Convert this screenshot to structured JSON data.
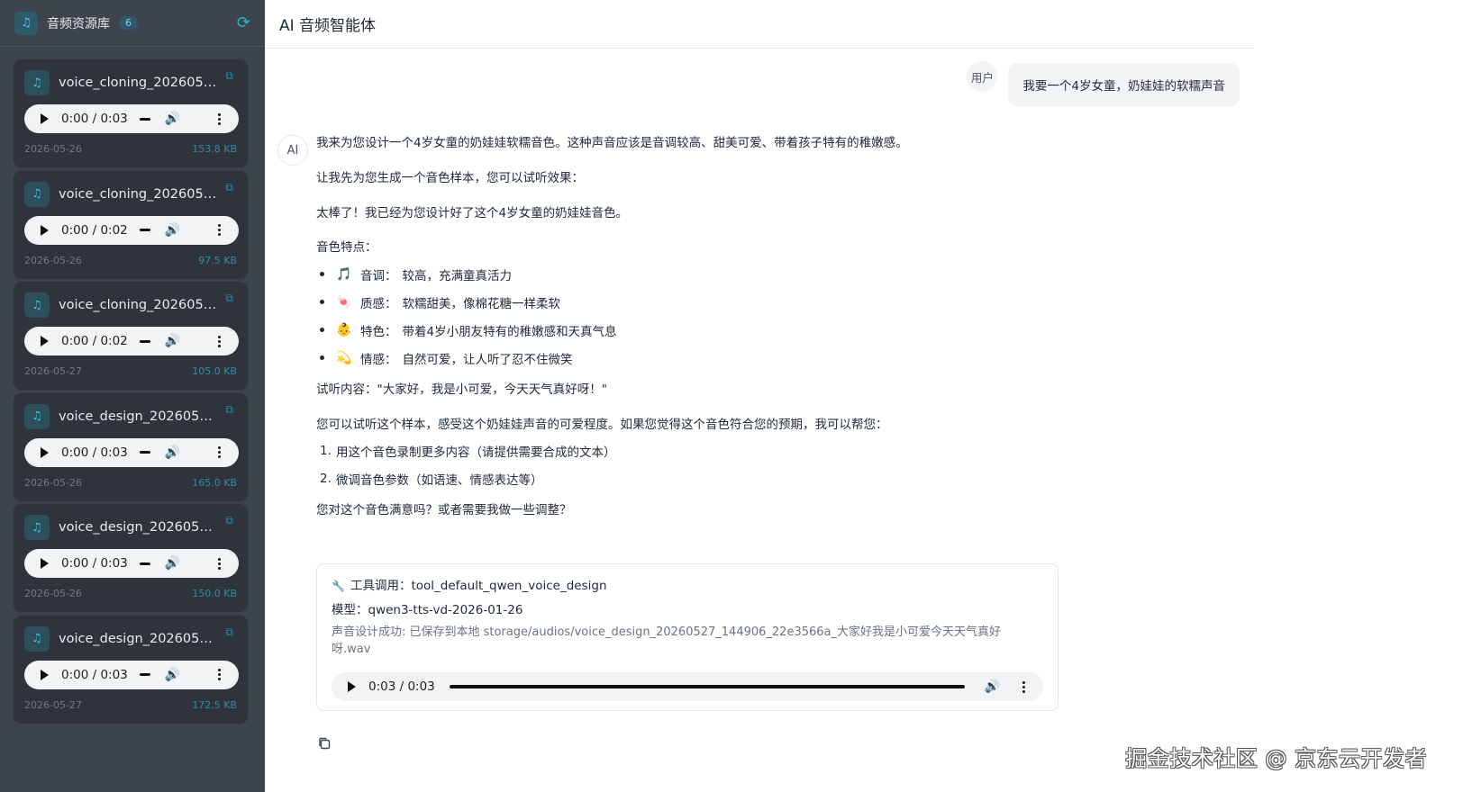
{
  "sidebar": {
    "title": "音频资源库",
    "count": "6",
    "music_icon": "music-note-icon",
    "refresh_icon": "refresh-icon",
    "items": [
      {
        "name": "voice_cloning_2026052...",
        "time": "0:00 / 0:03",
        "date": "2026-05-26",
        "size": "153.8 KB"
      },
      {
        "name": "voice_cloning_2026052...",
        "time": "0:00 / 0:02",
        "date": "2026-05-26",
        "size": "97.5 KB"
      },
      {
        "name": "voice_cloning_2026052...",
        "time": "0:00 / 0:02",
        "date": "2026-05-27",
        "size": "105.0 KB"
      },
      {
        "name": "voice_design_2026052...",
        "time": "0:00 / 0:03",
        "date": "2026-05-26",
        "size": "165.0 KB"
      },
      {
        "name": "voice_design_2026052...",
        "time": "0:00 / 0:03",
        "date": "2026-05-26",
        "size": "150.0 KB"
      },
      {
        "name": "voice_design_2026052...",
        "time": "0:00 / 0:03",
        "date": "2026-05-27",
        "size": "172.5 KB"
      }
    ]
  },
  "header": {
    "title": "AI 音频智能体"
  },
  "user": {
    "label": "用户",
    "message": "我要一个4岁女童，奶娃娃的软糯声音"
  },
  "ai": {
    "label": "AI",
    "p1": "我来为您设计一个4岁女童的奶娃娃软糯音色。这种声音应该是音调较高、甜美可爱、带着孩子特有的稚嫩感。",
    "p2": "让我先为您生成一个音色样本，您可以试听效果：",
    "p3": "太棒了！我已经为您设计好了这个4岁女童的奶娃娃音色。",
    "p4": "音色特点：",
    "features": [
      {
        "emoji": "🎵",
        "label": "音调：",
        "text": "较高，充满童真活力"
      },
      {
        "emoji": "🍬",
        "label": "质感：",
        "text": "软糯甜美，像棉花糖一样柔软"
      },
      {
        "emoji": "👶",
        "label": "特色：",
        "text": "带着4岁小朋友特有的稚嫩感和天真气息"
      },
      {
        "emoji": "💫",
        "label": "情感：",
        "text": "自然可爱，让人听了忍不住微笑"
      }
    ],
    "p5": "试听内容：\"大家好，我是小可爱，今天天气真好呀！\"",
    "p6": "您可以试听这个样本，感受这个奶娃娃声音的可爱程度。如果您觉得这个音色符合您的预期，我可以帮您：",
    "options": [
      {
        "n": "1.",
        "text": "用这个音色录制更多内容（请提供需要合成的文本）"
      },
      {
        "n": "2.",
        "text": "微调音色参数（如语速、情感表达等）"
      }
    ],
    "p7": "您对这个音色满意吗？或者需要我做一些调整？"
  },
  "tool": {
    "icon": "wrench-icon",
    "call_label": "工具调用：tool_default_qwen_voice_design",
    "model_label": "模型：qwen3-tts-vd-2026-01-26",
    "result": "声音设计成功: 已保存到本地 storage/audios/voice_design_20260527_144906_22e3566a_大家好我是小可爱今天天气真好呀.wav",
    "audio_time": "0:03 / 0:03",
    "audio_progress": 1.0
  },
  "watermark": "掘金技术社区 @ 京东云开发者"
}
